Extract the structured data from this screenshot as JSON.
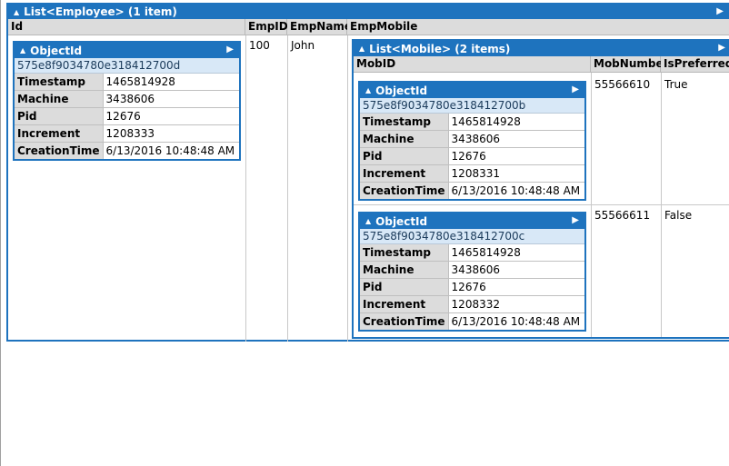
{
  "employee_list": {
    "title": "List<Employee> (1 item)",
    "columns": [
      "Id",
      "EmpID",
      "EmpName",
      "EmpMobile"
    ],
    "row": {
      "emp_id": "100",
      "emp_name": "John",
      "id": {
        "title": "ObjectId",
        "value": "575e8f9034780e318412700d",
        "fields": [
          {
            "key": "Timestamp",
            "value": "1465814928"
          },
          {
            "key": "Machine",
            "value": "3438606"
          },
          {
            "key": "Pid",
            "value": "12676"
          },
          {
            "key": "Increment",
            "value": "1208333"
          },
          {
            "key": "CreationTime",
            "value": "6/13/2016 10:48:48 AM"
          }
        ]
      }
    }
  },
  "mobile_list": {
    "title": "List<Mobile> (2 items)",
    "columns": [
      "MobID",
      "MobNumber",
      "IsPreferred"
    ],
    "rows": [
      {
        "mob_number": "55566610",
        "is_preferred": "True",
        "mob_id": {
          "title": "ObjectId",
          "value": "575e8f9034780e318412700b",
          "fields": [
            {
              "key": "Timestamp",
              "value": "1465814928"
            },
            {
              "key": "Machine",
              "value": "3438606"
            },
            {
              "key": "Pid",
              "value": "12676"
            },
            {
              "key": "Increment",
              "value": "1208331"
            },
            {
              "key": "CreationTime",
              "value": "6/13/2016 10:48:48 AM"
            }
          ]
        }
      },
      {
        "mob_number": "55566611",
        "is_preferred": "False",
        "mob_id": {
          "title": "ObjectId",
          "value": "575e8f9034780e318412700c",
          "fields": [
            {
              "key": "Timestamp",
              "value": "1465814928"
            },
            {
              "key": "Machine",
              "value": "3438606"
            },
            {
              "key": "Pid",
              "value": "12676"
            },
            {
              "key": "Increment",
              "value": "1208332"
            },
            {
              "key": "CreationTime",
              "value": "6/13/2016 10:48:48 AM"
            }
          ]
        }
      }
    ]
  },
  "icons": {
    "collapse": "triangle-up-icon",
    "expand": "triangle-right-icon"
  },
  "colors": {
    "header_blue": "#1e73be",
    "header_gray": "#dcdcdc",
    "id_row": "#d8e8f7"
  }
}
